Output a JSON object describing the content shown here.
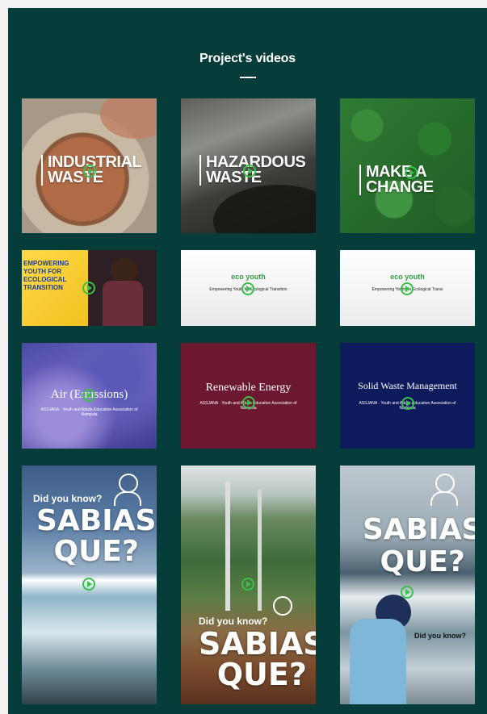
{
  "section": {
    "title": "Project's videos"
  },
  "videos": [
    {
      "title_line1": "INDUSTRIAL",
      "title_line2": "WASTE"
    },
    {
      "title_line1": "HAZARDOUS",
      "title_line2": "WASTE"
    },
    {
      "title_line1": "MAKE A",
      "title_line2": "CHANGE"
    },
    {
      "banner_l1": "EMPOWERING",
      "banner_l2": "YOUTH FOR",
      "banner_l3": "ECOLOGICAL",
      "banner_l4": "TRANSITION"
    },
    {
      "logo": "eco youth",
      "caption_l1": "Empowering Youth for Ecological Transition",
      "caption_l2": ""
    },
    {
      "logo": "eco youth",
      "caption_l1": "Empowering Youth for Ecological Transi",
      "caption_l2": ""
    },
    {
      "title": "Air (Emissions)",
      "org": "ASSJANA · Youth and Adults Education Association of Nampula"
    },
    {
      "title": "Renewable Energy",
      "org": "ASSJANA · Youth and Adults Education Association of Nampula"
    },
    {
      "title": "Solid Waste Management",
      "org": "ASSJANA · Youth and Adults Education Association of Nampula"
    },
    {
      "question": "Did you know?",
      "big_l1": "SABIAS",
      "big_l2": "QUE?"
    },
    {
      "question": "Did you know?",
      "big_l1": "SABIAS",
      "big_l2": "QUE?"
    },
    {
      "question": "Did you know?",
      "big_l1": "SABIAS",
      "big_l2": "QUE?"
    }
  ]
}
